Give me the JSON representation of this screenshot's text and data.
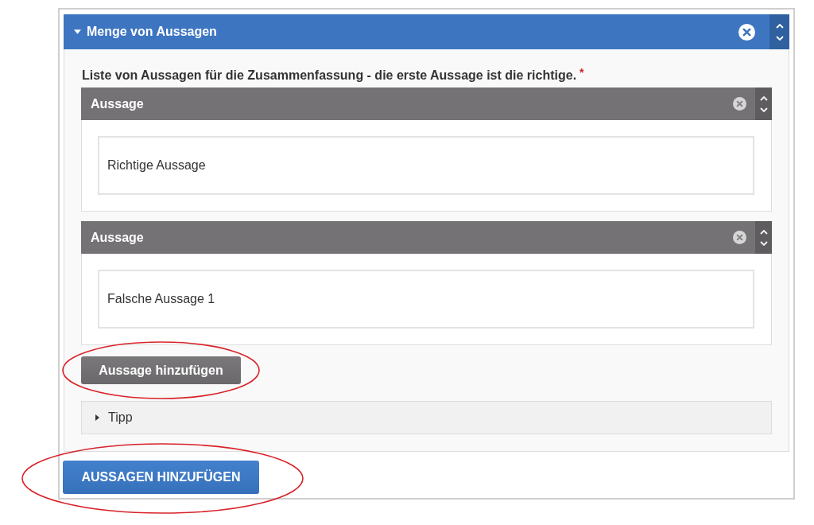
{
  "panel": {
    "title": "Menge von Aussagen",
    "expanded": true,
    "field_label": "Liste von Aussagen für die Zusammenfassung - die erste Aussage ist die richtige.",
    "required_mark": "*",
    "items": [
      {
        "title": "Aussage",
        "value": "Richtige Aussage"
      },
      {
        "title": "Aussage",
        "value": "Falsche Aussage 1"
      }
    ],
    "add_button": {
      "label": "Aussage hinzufügen",
      "circled": true
    },
    "hint": {
      "label": "Tipp",
      "expanded": false
    }
  },
  "submit_button": {
    "label": "AUSSAGEN HINZUFÜGEN",
    "circled": true
  }
}
